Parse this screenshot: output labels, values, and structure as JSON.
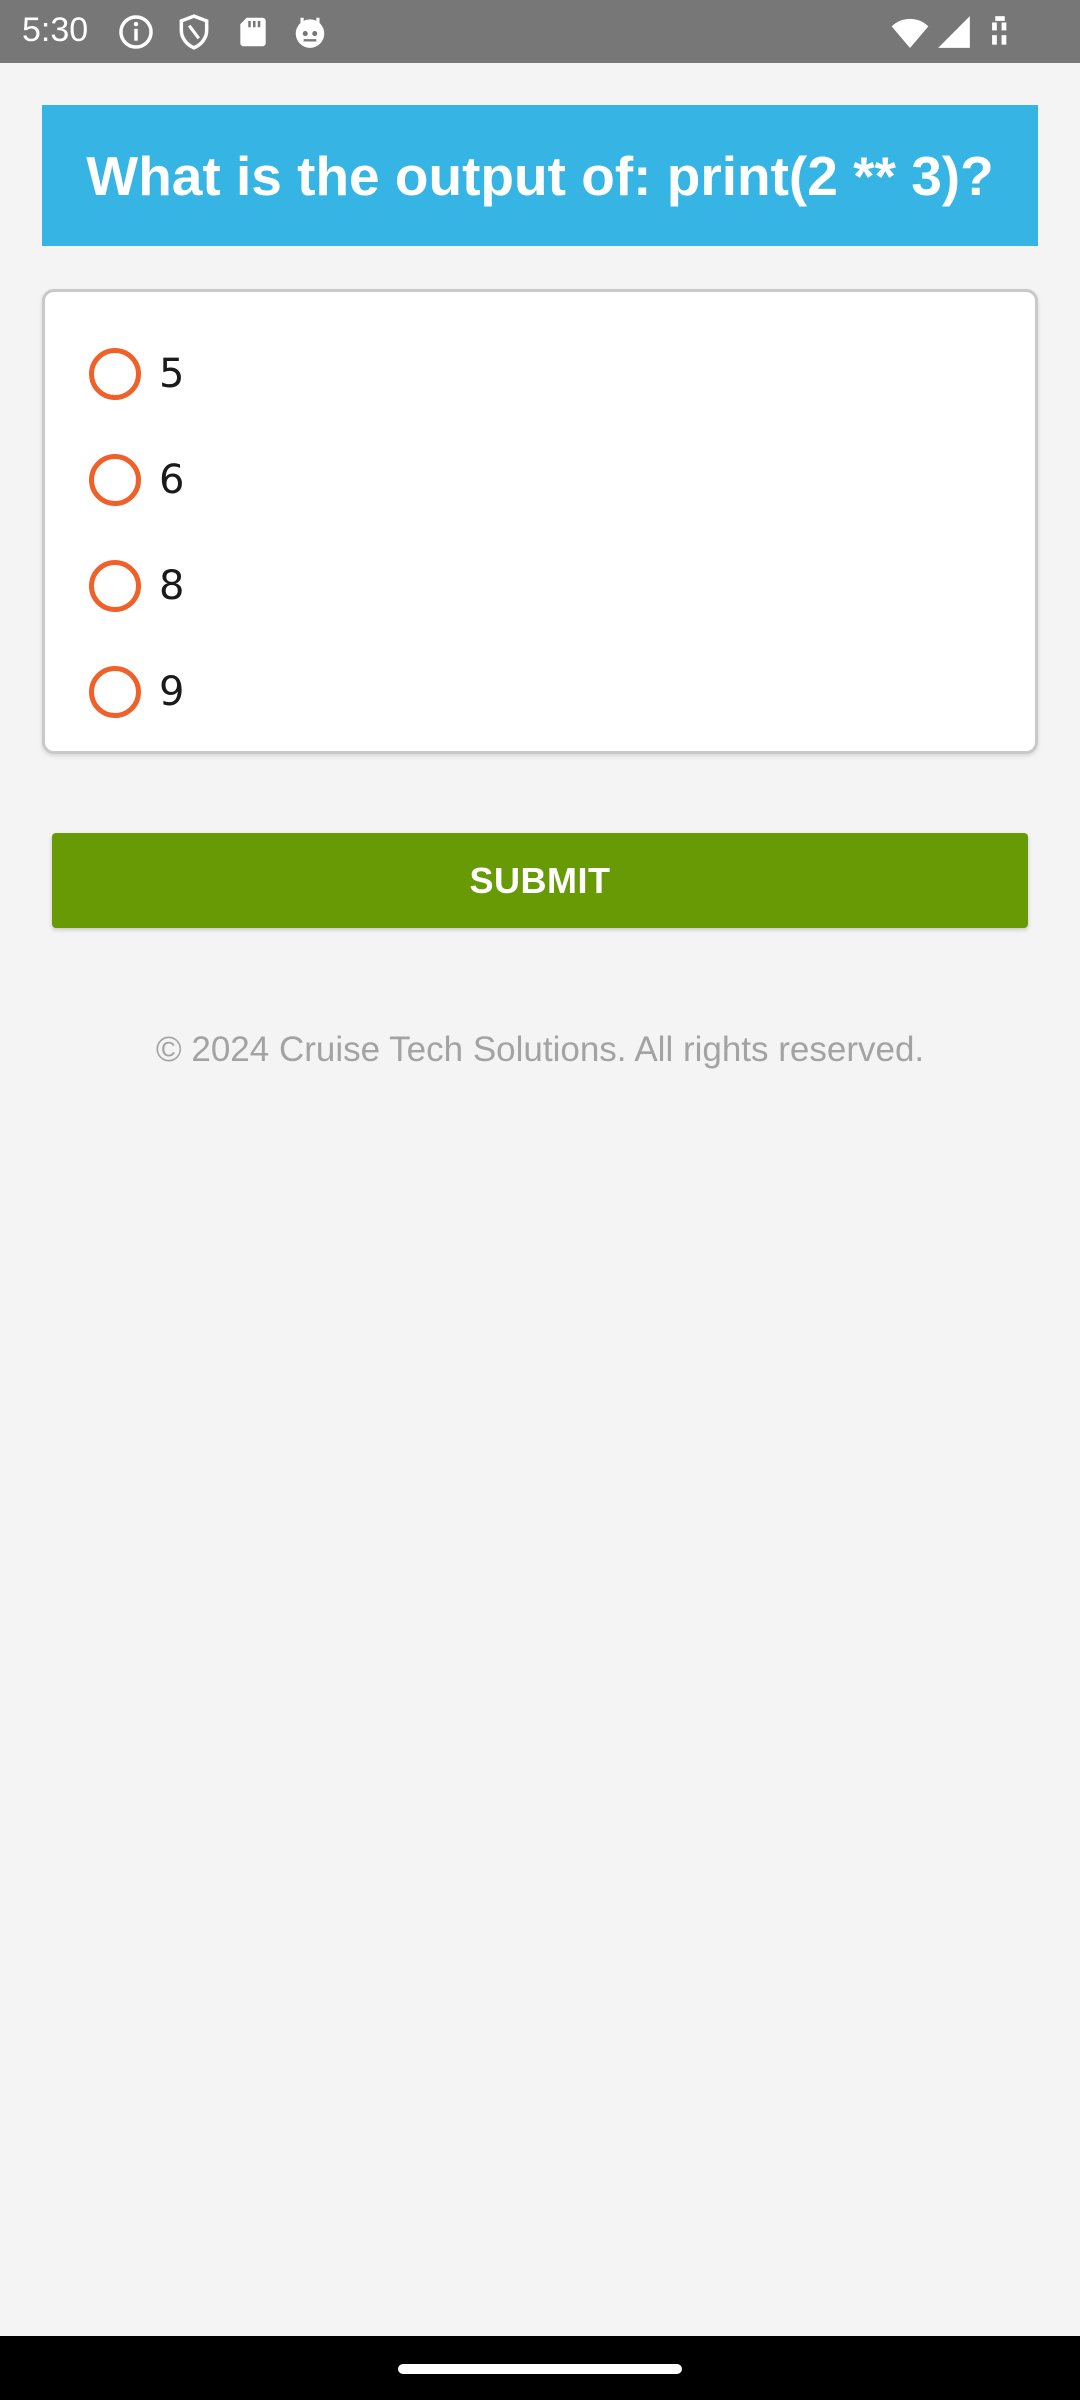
{
  "status_bar": {
    "time": "5:30",
    "icons_left": [
      "info-icon",
      "shield-icon",
      "sd-card-icon",
      "robot-face-icon"
    ],
    "icons_right": [
      "wifi-icon",
      "cell-signal-icon",
      "battery-icon"
    ]
  },
  "quiz": {
    "question": "What is the output of: print(2 ** 3)?",
    "options": [
      {
        "label": "5",
        "selected": false
      },
      {
        "label": "6",
        "selected": false
      },
      {
        "label": "8",
        "selected": false
      },
      {
        "label": "9",
        "selected": false
      }
    ],
    "submit_label": "SUBMIT"
  },
  "footer": {
    "text": "© 2024 Cruise Tech Solutions. All rights reserved."
  },
  "colors": {
    "header_bg": "#36b5e5",
    "radio_accent": "#f0612a",
    "submit_bg": "#679a05",
    "page_bg": "#f4f4f4"
  }
}
